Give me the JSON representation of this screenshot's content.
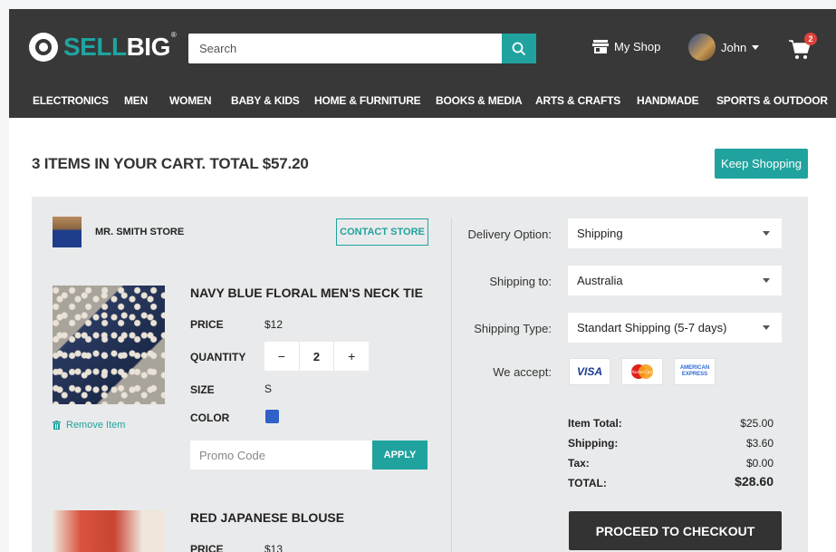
{
  "header": {
    "logo_sell": "SELL",
    "logo_big": "BIG",
    "logo_reg": "®",
    "search_placeholder": "Search",
    "my_shop": "My Shop",
    "user_name": "John",
    "cart_count": "2"
  },
  "categories": [
    "ELECTRONICS",
    "MEN",
    "WOMEN",
    "BABY & KIDS",
    "HOME & FURNITURE",
    "BOOKS & MEDIA",
    "ARTS & CRAFTS",
    "HANDMADE",
    "SPORTS & OUTDOOR"
  ],
  "cart": {
    "title": "3 ITEMS IN YOUR CART. TOTAL $57.20",
    "keep_shopping": "Keep Shopping"
  },
  "store": {
    "name": "MR. SMITH STORE",
    "contact": "CONTACT STORE"
  },
  "items": [
    {
      "name": "NAVY BLUE FLORAL MEN'S NECK TIE",
      "price_label": "PRICE",
      "price": "$12",
      "quantity_label": "QUANTITY",
      "quantity": "2",
      "size_label": "SIZE",
      "size": "S",
      "color_label": "COLOR",
      "color": "#2f61c7",
      "remove": "Remove Item"
    },
    {
      "name": "RED JAPANESE BLOUSE",
      "price_label": "PRICE",
      "price": "$13"
    }
  ],
  "qty_controls": {
    "minus": "−",
    "plus": "+"
  },
  "promo": {
    "placeholder": "Promo Code",
    "apply": "APPLY"
  },
  "shipping": {
    "delivery_label": "Delivery Option:",
    "delivery_value": "Shipping",
    "to_label": "Shipping to:",
    "to_value": "Australia",
    "type_label": "Shipping Type:",
    "type_value": "Standart Shipping (5-7 days)",
    "accept_label": "We accept:",
    "cards": {
      "visa": "VISA",
      "amex_line1": "AMERICAN",
      "amex_line2": "EXPRESS",
      "mc": "MasterCard"
    }
  },
  "summary": {
    "item_total_label": "Item Total:",
    "item_total": "$25.00",
    "shipping_label": "Shipping:",
    "shipping": "$3.60",
    "tax_label": "Tax:",
    "tax": "$0.00",
    "total_label": "TOTAL:",
    "total": "$28.60"
  },
  "checkout": "PROCEED TO CHECKOUT",
  "colors": {
    "accent": "#20a39e",
    "header": "#383838",
    "panel": "#e9eaeb"
  }
}
